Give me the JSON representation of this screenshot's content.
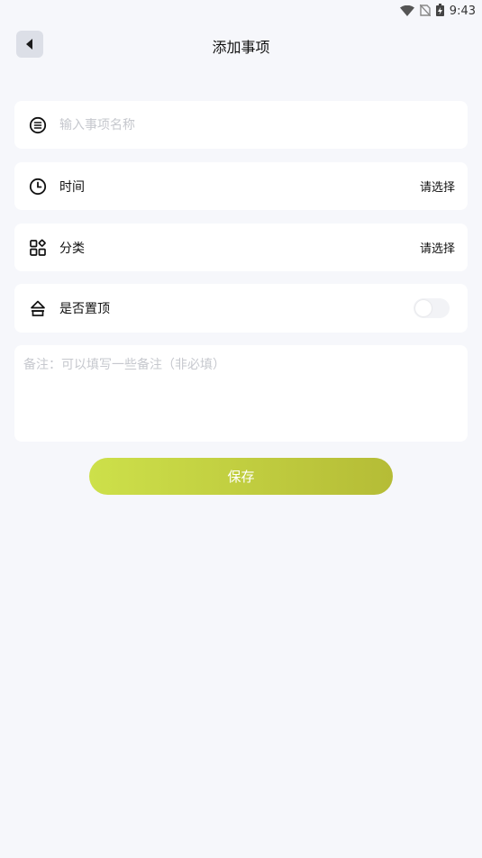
{
  "status_bar": {
    "time": "9:43"
  },
  "header": {
    "title": "添加事项"
  },
  "form": {
    "name_placeholder": "输入事项名称",
    "time": {
      "label": "时间",
      "value": "请选择"
    },
    "category": {
      "label": "分类",
      "value": "请选择"
    },
    "pin": {
      "label": "是否置顶",
      "enabled": false
    },
    "note_placeholder": "备注：可以填写一些备注（非必填）"
  },
  "actions": {
    "save_label": "保存"
  },
  "colors": {
    "background": "#f6f7fb",
    "save_gradient_start": "#cde04a",
    "save_gradient_end": "#b5bc36"
  }
}
